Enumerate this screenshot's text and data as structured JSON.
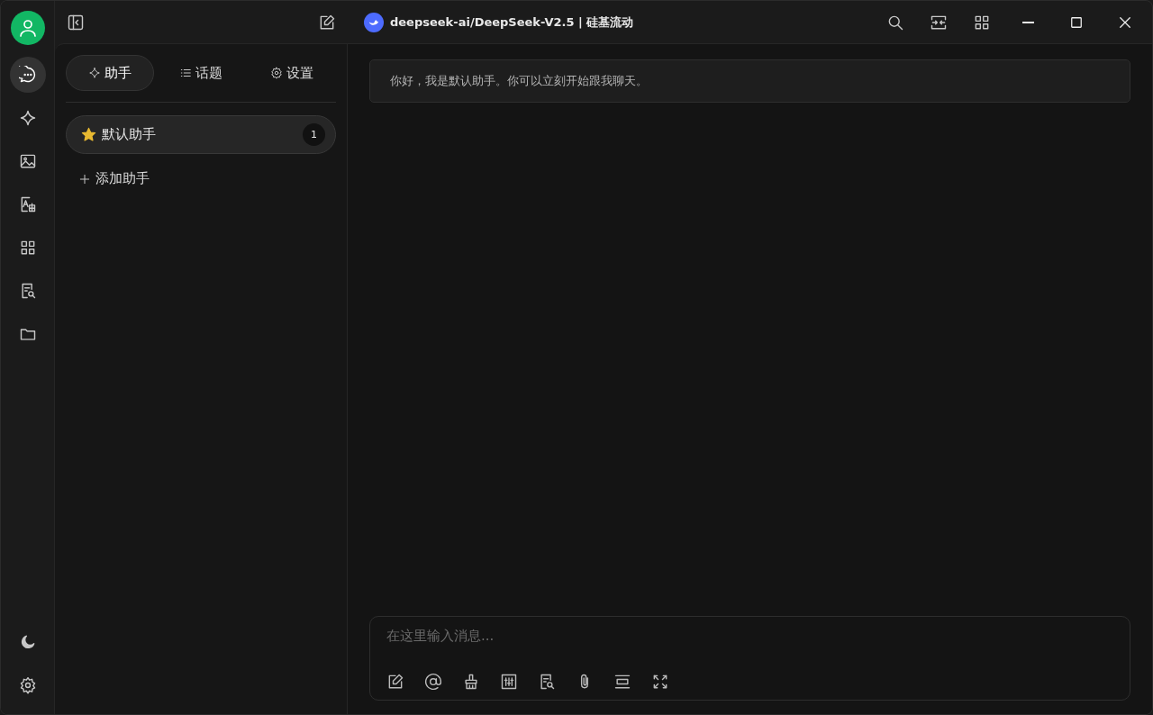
{
  "nav_rail": {
    "items": [
      {
        "selected": true
      },
      {
        "selected": false
      },
      {
        "selected": false
      },
      {
        "selected": false
      },
      {
        "selected": false
      },
      {
        "selected": false
      },
      {
        "selected": false
      }
    ]
  },
  "title_bar": {
    "model": "deepseek-ai/DeepSeek-V2.5 | 硅基流动"
  },
  "sidebar": {
    "tabs": [
      {
        "label": "助手",
        "selected": true
      },
      {
        "label": "话题",
        "selected": false
      },
      {
        "label": "设置",
        "selected": false
      }
    ],
    "assistants": [
      {
        "name": "默认助手",
        "count": "1",
        "selected": true
      }
    ],
    "add_button": "添加助手"
  },
  "chat": {
    "messages": [
      {
        "text": "你好，我是默认助手。你可以立刻开始跟我聊天。"
      }
    ],
    "input": {
      "placeholder": "在这里输入消息..."
    }
  }
}
